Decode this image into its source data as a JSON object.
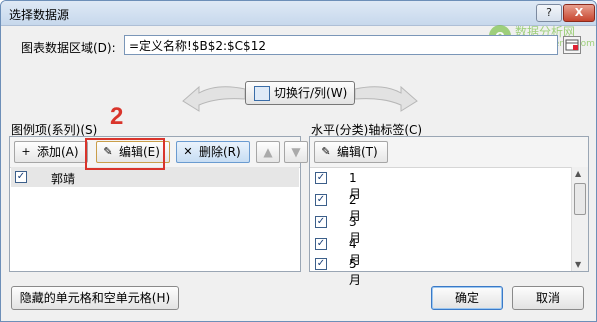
{
  "dialog": {
    "title": "选择数据源",
    "help_glyph": "?",
    "close_glyph": "X"
  },
  "range": {
    "label": "图表数据区域(D):",
    "value": "=定义名称!$B$2:$C$12"
  },
  "switch_button": "切换行/列(W)",
  "series_panel": {
    "label": "图例项(系列)(S)",
    "add": "添加(A)",
    "edit": "编辑(E)",
    "delete": "删除(R)",
    "up": "▲",
    "down": "▼",
    "items": [
      {
        "checked": true,
        "label": "郭靖"
      }
    ]
  },
  "axis_panel": {
    "label": "水平(分类)轴标签(C)",
    "edit": "编辑(T)",
    "items": [
      {
        "checked": true,
        "label": "1月"
      },
      {
        "checked": true,
        "label": "2月"
      },
      {
        "checked": true,
        "label": "3月"
      },
      {
        "checked": true,
        "label": "4月"
      },
      {
        "checked": true,
        "label": "5月"
      }
    ]
  },
  "annotation": {
    "number": "2",
    "color": "#d9342b"
  },
  "watermark": {
    "logo": "e",
    "text": "数据分析网",
    "url": "www.afenxi.com"
  },
  "buttons": {
    "hidden_cells": "隐藏的单元格和空单元格(H)",
    "ok": "确定",
    "cancel": "取消"
  },
  "colors": {
    "accent": "#3a79c7",
    "title_bar": "#c7d8ec",
    "highlight": "#d9342b"
  }
}
